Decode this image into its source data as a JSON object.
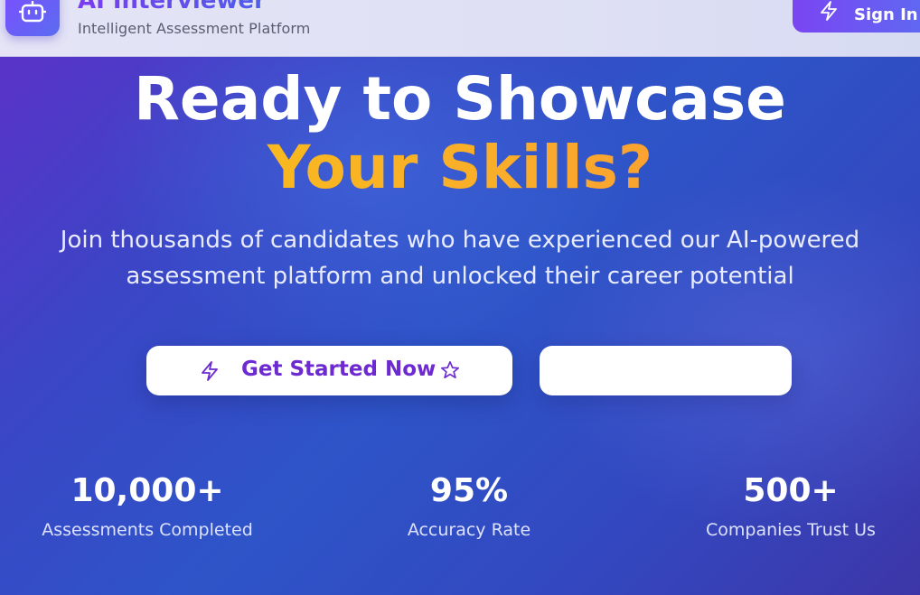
{
  "header": {
    "brand_title": "AI Interviewer",
    "brand_subtitle": "Intelligent Assessment Platform",
    "logo_icon": "robot-icon",
    "signin_label": "Sign In",
    "signin_icon": "lightning-icon"
  },
  "hero": {
    "headline_line1": "Ready to Showcase",
    "headline_line2": "Your Skills?",
    "subtext": "Join thousands of candidates who have experienced our AI-powered assessment platform and unlocked their career potential",
    "primary_cta": {
      "label": "Get Started Now",
      "left_icon": "lightning-icon",
      "right_icon": "star-icon"
    },
    "secondary_cta": {
      "label": ""
    }
  },
  "stats": [
    {
      "value": "10,000+",
      "label": "Assessments Completed"
    },
    {
      "value": "95%",
      "label": "Accuracy Rate"
    },
    {
      "value": "500+",
      "label": "Companies Trust Us"
    }
  ],
  "colors": {
    "accent_purple": "#6d2ad0",
    "headline_gold": "#f8c514",
    "headline_orange": "#fb8f3e",
    "hero_blue": "#2e54c8",
    "header_bg": "#e4e4f6"
  }
}
